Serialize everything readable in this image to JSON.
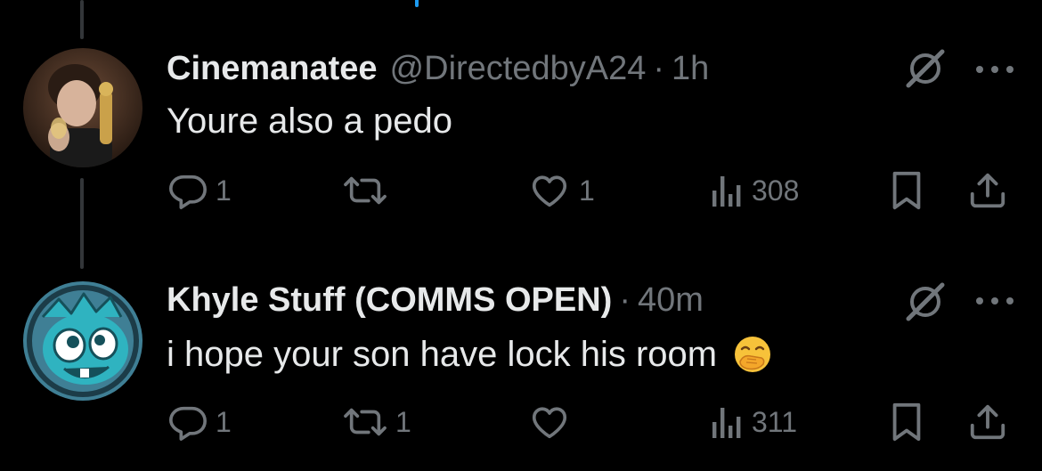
{
  "tweets": [
    {
      "display_name": "Cinemanatee",
      "handle": "@DirectedbyA24",
      "separator": "·",
      "time": "1h",
      "text": "Youre also a pedo",
      "replies": "1",
      "reposts": "",
      "likes": "1",
      "views": "308"
    },
    {
      "display_name": "Khyle Stuff (COMMS OPEN)",
      "handle": "",
      "separator": "·",
      "time": "40m",
      "text": "i hope your son have lock his room",
      "replies": "1",
      "reposts": "1",
      "likes": "",
      "views": "311"
    }
  ],
  "icons": {
    "reply": "reply-icon",
    "repost": "repost-icon",
    "like": "like-icon",
    "views": "views-icon",
    "bookmark": "bookmark-icon",
    "share": "share-icon",
    "grok": "grok-icon",
    "more": "more-icon",
    "emoji": "face-with-hand-over-mouth-emoji"
  },
  "colors": {
    "background": "#000000",
    "text_primary": "#e7e9ea",
    "text_secondary": "#71767b",
    "accent": "#1d9bf0",
    "thread_line": "#333639"
  }
}
